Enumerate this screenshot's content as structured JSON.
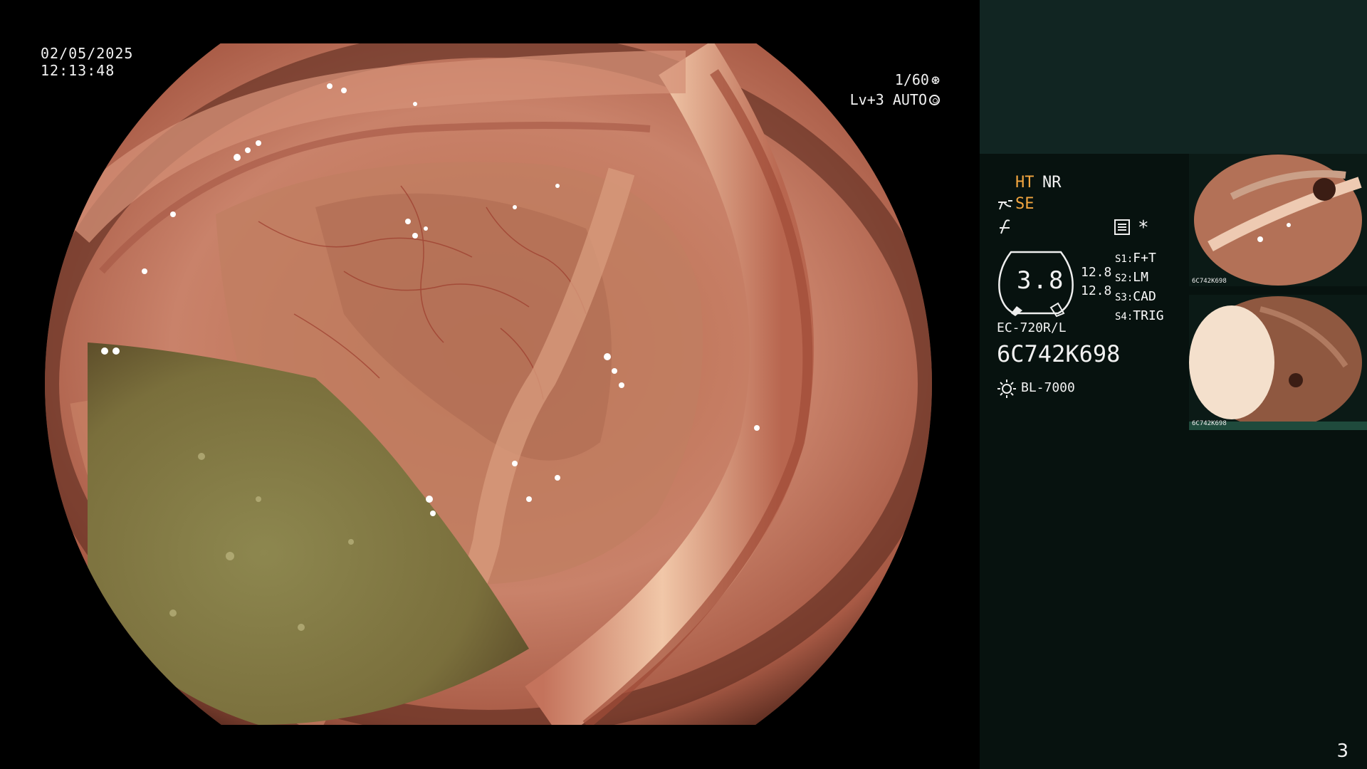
{
  "overlay": {
    "date": "02/05/2025",
    "time": "12:13:48",
    "shutter": "1/60",
    "exposure": "Lv+3 AUTO"
  },
  "panel": {
    "modes": {
      "ht": "HT",
      "nr": "NR",
      "se": "SE"
    },
    "zoom_value": "3.8",
    "val_1": "12.8",
    "val_2": "12.8",
    "switches": [
      {
        "key": "S1",
        "value": "F+T"
      },
      {
        "key": "S2",
        "value": "LM"
      },
      {
        "key": "S3",
        "value": "CAD"
      },
      {
        "key": "S4",
        "value": "TRIG"
      }
    ],
    "asterisk": "*",
    "scope_model": "EC-720R/L",
    "serial": "6C742K698",
    "light_source": "BL-7000",
    "thumb1_serial": "6C742K698",
    "thumb2_serial": "6C742K698",
    "page_number": "3"
  },
  "colors": {
    "panel_bg": "#07120f",
    "panel_top": "#112522",
    "accent_orange": "#f3a640"
  }
}
